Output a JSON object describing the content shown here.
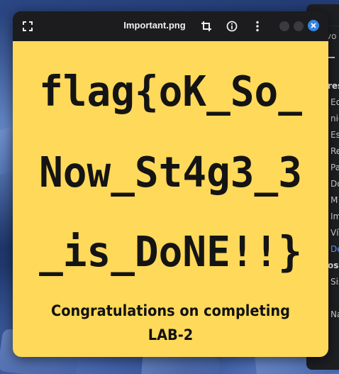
{
  "window": {
    "title": "Important.png"
  },
  "toolbar": {
    "fullscreen_icon": "fullscreen-icon",
    "crop_icon": "crop-icon",
    "info_icon": "info-icon",
    "menu_icon": "vertical-dots-icon",
    "close_color": "#3584e4"
  },
  "image": {
    "background_color": "#ffd95a",
    "flag_lines": [
      "flag{oK_So_",
      "Now_St4g3_3",
      "_is_DoNE!!}"
    ],
    "congrats_lines": [
      "Congratulations on completing",
      "LAB-2"
    ]
  },
  "background_app": {
    "header_text": "vo",
    "items": [
      {
        "label": "res",
        "type": "section"
      },
      {
        "label": "Ec",
        "type": "item"
      },
      {
        "label": "nic",
        "type": "item"
      },
      {
        "label": "Es",
        "type": "item"
      },
      {
        "label": "Re",
        "type": "item"
      },
      {
        "label": "Pa",
        "type": "item"
      },
      {
        "label": "Do",
        "type": "item"
      },
      {
        "label": "M",
        "type": "item"
      },
      {
        "label": "Im",
        "type": "item"
      },
      {
        "label": "Ví",
        "type": "item"
      },
      {
        "label": "De",
        "type": "active"
      },
      {
        "label": "osi",
        "type": "section"
      },
      {
        "label": "Sis",
        "type": "item"
      },
      {
        "label": "",
        "type": "item"
      },
      {
        "label": "Na",
        "type": "item"
      }
    ]
  }
}
